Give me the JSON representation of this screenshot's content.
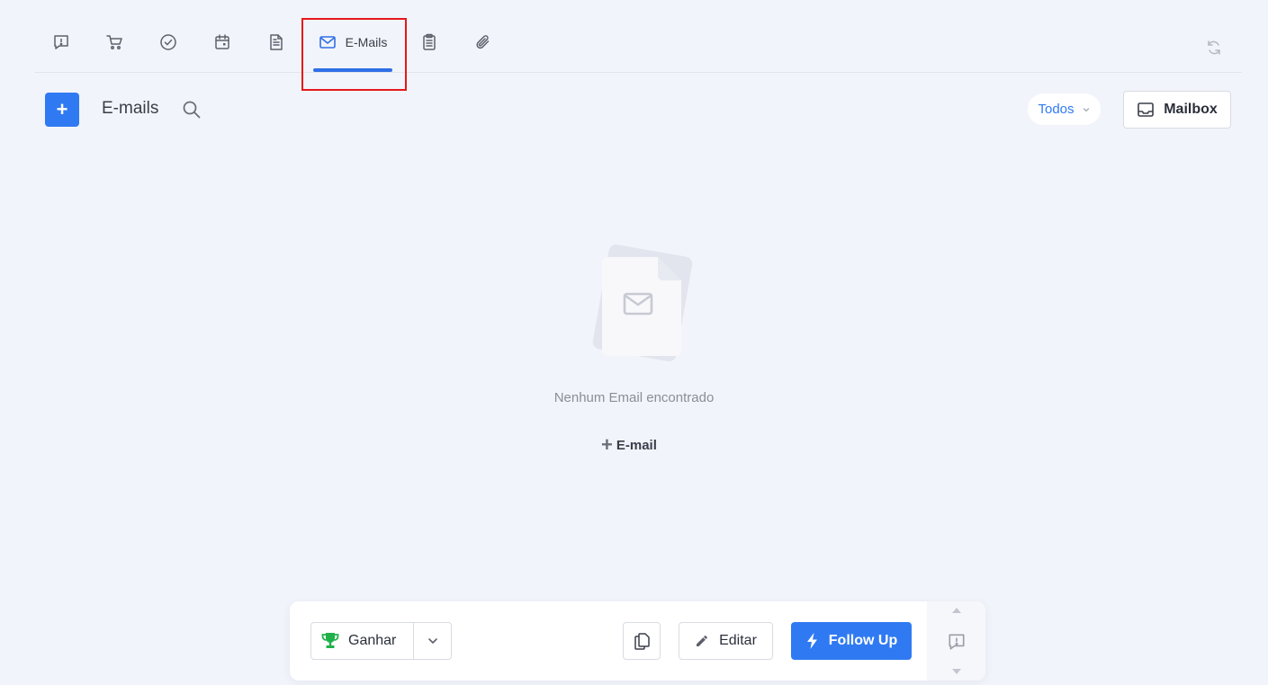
{
  "tabs": [
    {
      "icon": "alert-square-icon",
      "label": ""
    },
    {
      "icon": "cart-icon",
      "label": ""
    },
    {
      "icon": "check-circle-icon",
      "label": ""
    },
    {
      "icon": "calendar-icon",
      "label": ""
    },
    {
      "icon": "document-icon",
      "label": ""
    },
    {
      "icon": "mail-icon",
      "label": "E-Mails",
      "active": true
    },
    {
      "icon": "clipboard-icon",
      "label": ""
    },
    {
      "icon": "paperclip-icon",
      "label": ""
    }
  ],
  "header": {
    "title": "E-mails",
    "add_label": "+",
    "filter_value": "Todos",
    "mailbox_label": "Mailbox"
  },
  "empty_state": {
    "message": "Nenhum Email encontrado",
    "add_plus": "+",
    "add_label": "E-mail"
  },
  "action_bar": {
    "win_label": "Ganhar",
    "edit_label": "Editar",
    "followup_label": "Follow Up"
  },
  "colors": {
    "accent": "#2f7af2",
    "background": "#f2f4fb",
    "highlight": "#e4181a",
    "trophy": "#1fb14a"
  }
}
